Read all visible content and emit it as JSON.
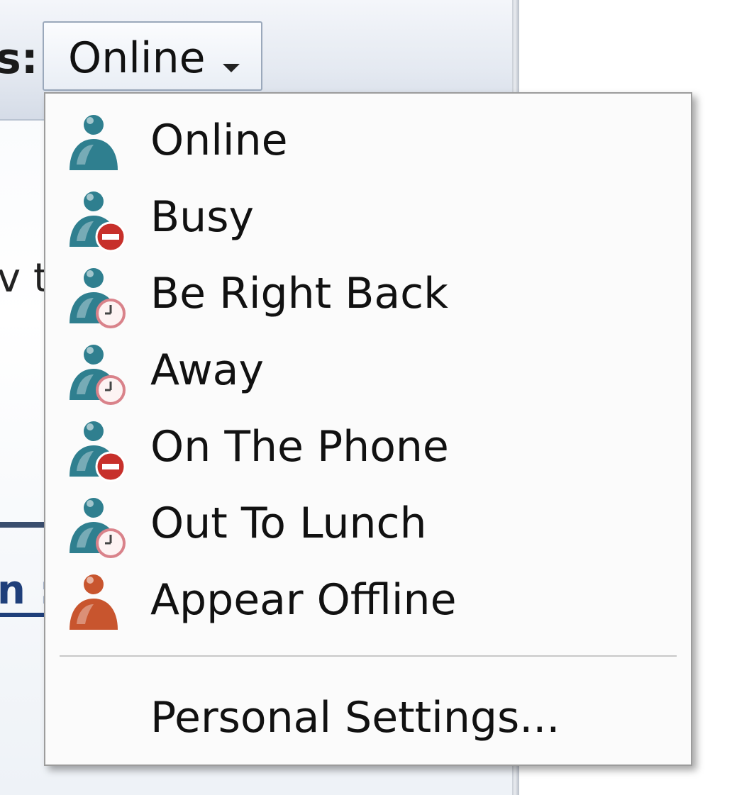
{
  "status_bar": {
    "label_fragment": "s:",
    "current_status": "Online"
  },
  "background": {
    "partial_text": "v t",
    "partial_link": "n :"
  },
  "menu": {
    "items": [
      {
        "label": "Online",
        "icon": "user-online-icon",
        "badge": "none",
        "person_color": "#2f7f8f"
      },
      {
        "label": "Busy",
        "icon": "user-busy-icon",
        "badge": "busy",
        "person_color": "#2f7f8f"
      },
      {
        "label": "Be Right Back",
        "icon": "user-brb-icon",
        "badge": "clock",
        "person_color": "#2f7f8f"
      },
      {
        "label": "Away",
        "icon": "user-away-icon",
        "badge": "clock",
        "person_color": "#2f7f8f"
      },
      {
        "label": "On The Phone",
        "icon": "user-phone-icon",
        "badge": "busy",
        "person_color": "#2f7f8f"
      },
      {
        "label": "Out To Lunch",
        "icon": "user-lunch-icon",
        "badge": "clock",
        "person_color": "#2f7f8f"
      },
      {
        "label": "Appear Offline",
        "icon": "user-offline-icon",
        "badge": "none",
        "person_color": "#c8552e"
      }
    ],
    "settings_label": "Personal Settings..."
  },
  "colors": {
    "online_person": "#2f7f8f",
    "offline_person": "#c8552e",
    "busy_badge": "#c7302b",
    "clock_badge_ring": "#d9828a"
  }
}
